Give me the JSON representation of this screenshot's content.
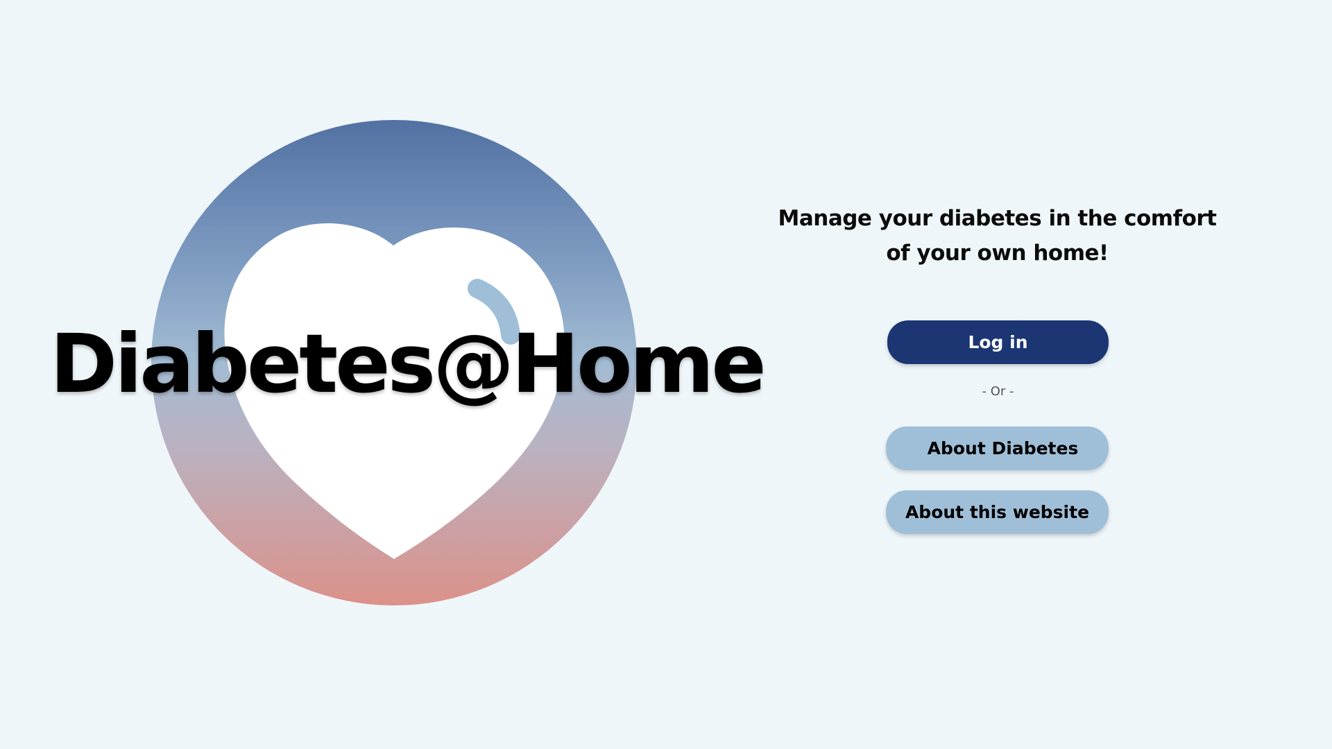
{
  "app": {
    "title": "Diabetes@Home"
  },
  "hero": {
    "logo_icon": "heart-icon",
    "colors": {
      "background": "#eff6fa",
      "circle_top": "#5271a3",
      "circle_bottom": "#db9189",
      "heart": "#ffffff",
      "heart_shine": "#9fbfd8"
    }
  },
  "panel": {
    "tagline": "Manage your diabetes in the comfort of your own home!",
    "login_label": "Log in",
    "or_separator": "- Or -",
    "about_diabetes_label": "About Diabetes",
    "about_website_label": "About this website",
    "colors": {
      "primary_button": "#1b3673",
      "secondary_button": "#9fbfd8"
    }
  }
}
